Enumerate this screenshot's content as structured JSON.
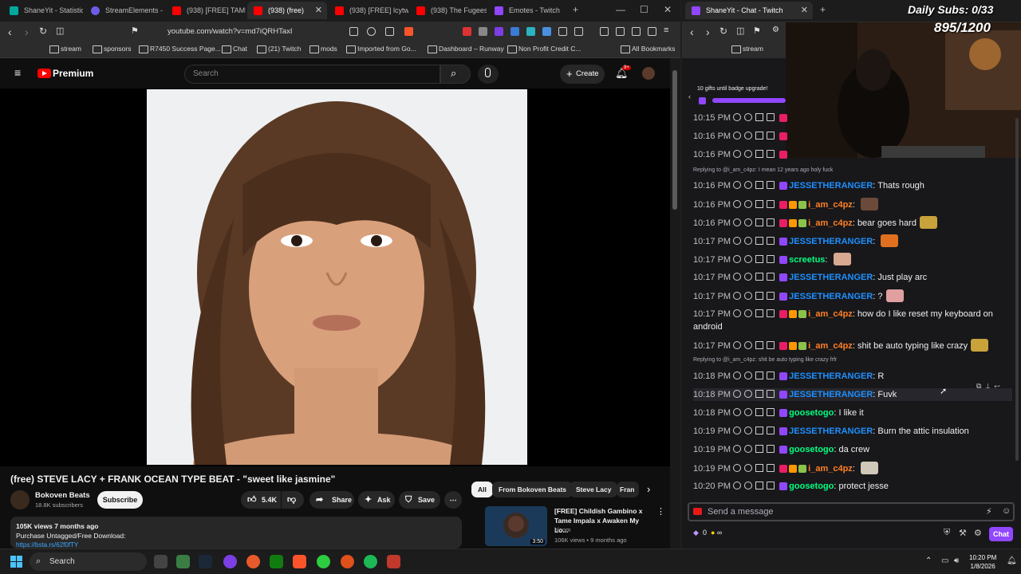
{
  "left_browser": {
    "tabs": [
      {
        "label": "ShaneYit - Statistic"
      },
      {
        "label": "StreamElements - S"
      },
      {
        "label": "(938) [FREE] TAME"
      },
      {
        "label": "(938) (free)"
      },
      {
        "label": "(938) [FREE] lcytwat Type"
      },
      {
        "label": "(938) The Fugees"
      },
      {
        "label": "Emotes - Twitch"
      }
    ],
    "url": "youtube.com/watch?v=md7iQRHTaxI",
    "bookmarks": [
      "stream",
      "sponsors",
      "R7450 Success Page...",
      "Chat",
      "(21) Twitch",
      "mods",
      "Imported from Go...",
      "Dashboard – Runway",
      "Non Profit Credit C...",
      "All Bookmarks"
    ]
  },
  "youtube": {
    "logo_text": "Premium",
    "search_placeholder": "Search",
    "create_label": "Create",
    "notif_count": "9+",
    "video_title": "(free) STEVE LACY + FRANK OCEAN TYPE BEAT - \"sweet like jasmine\"",
    "channel_name": "Bokoven Beats",
    "channel_subs": "18.8K subscribers",
    "subscribe_label": "Subscribe",
    "likes": "5.4K",
    "share_label": "Share",
    "ask_label": "Ask",
    "save_label": "Save",
    "desc_meta": "105K views  7 months ago",
    "desc_line": "Purchase Untagged/Free Download:",
    "desc_link": "https://bsta.rs/62f0fTY",
    "chips": [
      "All",
      "From Bokoven Beats",
      "Steve Lacy",
      "Fran"
    ],
    "rec": {
      "title": "[FREE] Childish Gambino x Tame Impala x Awaken My Lo...",
      "channel": "bloom",
      "meta": "106K views • 9 months ago",
      "duration": "3:50"
    }
  },
  "right_browser": {
    "tab": "ShaneYit - Chat - Twitch",
    "bookmark": "stream"
  },
  "overlay": {
    "goal_label": "Daily Subs: 0/33",
    "goal_count": "895/1200"
  },
  "twitch": {
    "gift_banner": "10 gifts until badge upgrade!",
    "messages": [
      {
        "ts": "10:15 PM",
        "user": "",
        "text": "",
        "color": "#ffffff"
      },
      {
        "ts": "10:16 PM",
        "user": "",
        "text": "",
        "color": "#ffffff"
      },
      {
        "ts": "10:16 PM",
        "user": "",
        "text": "",
        "color": "#ffffff"
      },
      {
        "reply": "Replying to @i_am_c4pz: I mean 12 years ago holy fuck"
      },
      {
        "ts": "10:16 PM",
        "user": "JESSETHERANGER",
        "text": "Thats rough",
        "color": "#1e90ff"
      },
      {
        "ts": "10:16 PM",
        "user": "i_am_c4pz",
        "text": "",
        "color": "#ff7f24",
        "emote": "#6b4a3a"
      },
      {
        "ts": "10:16 PM",
        "user": "i_am_c4pz",
        "text": "bear goes hard",
        "color": "#ff7f24",
        "emote": "#c8a23a"
      },
      {
        "ts": "10:17 PM",
        "user": "JESSETHERANGER",
        "text": "",
        "color": "#1e90ff",
        "emote": "#e07020"
      },
      {
        "ts": "10:17 PM",
        "user": "screetus",
        "text": "",
        "color": "#00ff7f",
        "emote": "#d8a890"
      },
      {
        "ts": "10:17 PM",
        "user": "JESSETHERANGER",
        "text": "Just play arc",
        "color": "#1e90ff"
      },
      {
        "ts": "10:17 PM",
        "user": "JESSETHERANGER",
        "text": "?",
        "color": "#1e90ff",
        "emote": "#e0a0a0"
      },
      {
        "ts": "10:17 PM",
        "user": "i_am_c4pz",
        "text": "how do I like reset my keyboard on android",
        "color": "#ff7f24"
      },
      {
        "ts": "10:17 PM",
        "user": "i_am_c4pz",
        "text": "shit be auto typing like crazy",
        "color": "#ff7f24",
        "emote": "#c8a23a"
      },
      {
        "reply": "Replying to @i_am_c4pz: shit be auto typing like crazy frfr"
      },
      {
        "ts": "10:18 PM",
        "user": "JESSETHERANGER",
        "text": "R",
        "color": "#1e90ff"
      },
      {
        "ts": "10:18 PM",
        "user": "JESSETHERANGER",
        "text": "Fuvk",
        "color": "#1e90ff"
      },
      {
        "ts": "10:18 PM",
        "user": "goosetogo",
        "text": "I like it",
        "color": "#00ff7f"
      },
      {
        "ts": "10:19 PM",
        "user": "JESSETHERANGER",
        "text": "Burn the attic insulation",
        "color": "#1e90ff"
      },
      {
        "ts": "10:19 PM",
        "user": "goosetogo",
        "text": "da crew",
        "color": "#00ff7f"
      },
      {
        "ts": "10:19 PM",
        "user": "i_am_c4pz",
        "text": "",
        "color": "#ff7f24",
        "emote": "#d0c8b8"
      },
      {
        "ts": "10:20 PM",
        "user": "goosetogo",
        "text": "protect jesse",
        "color": "#00ff7f"
      }
    ],
    "input_placeholder": "Send a message",
    "points": "0",
    "chat_button": "Chat"
  },
  "taskbar": {
    "search_label": "Search",
    "time": "10:20 PM",
    "date": "1/8/2026"
  }
}
